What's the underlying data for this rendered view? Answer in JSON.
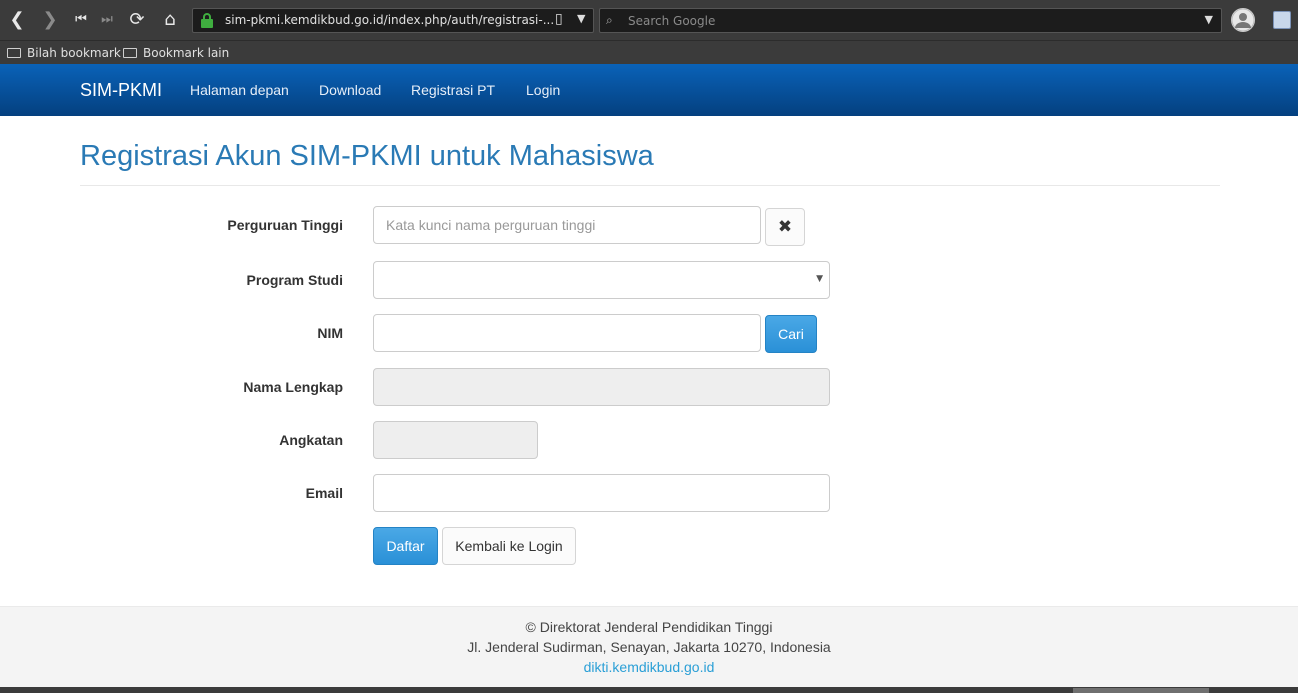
{
  "browser": {
    "url": "sim-pkmi.kemdikbud.go.id/index.php/auth/registrasi-...",
    "search_placeholder": "Search Google",
    "bookmarks": [
      "Bilah bookmark",
      "Bookmark lain"
    ]
  },
  "navbar": {
    "brand": "SIM-PKMI",
    "links": [
      "Halaman depan",
      "Download",
      "Registrasi PT",
      "Login"
    ]
  },
  "page": {
    "title": "Registrasi Akun SIM-PKMI untuk Mahasiswa"
  },
  "form": {
    "perguruan_tinggi": {
      "label": "Perguruan Tinggi",
      "placeholder": "Kata kunci nama perguruan tinggi",
      "value": ""
    },
    "program_studi": {
      "label": "Program Studi",
      "value": ""
    },
    "nim": {
      "label": "NIM",
      "value": "",
      "search_button": "Cari"
    },
    "nama_lengkap": {
      "label": "Nama Lengkap",
      "value": ""
    },
    "angkatan": {
      "label": "Angkatan",
      "value": ""
    },
    "email": {
      "label": "Email",
      "value": ""
    },
    "submit_button": "Daftar",
    "back_button": "Kembali ke Login"
  },
  "footer": {
    "line1": "© Direktorat Jenderal Pendidikan Tinggi",
    "line2": "Jl. Jenderal Sudirman, Senayan, Jakarta 10270, Indonesia",
    "link": "dikti.kemdikbud.go.id"
  },
  "colors": {
    "navbar": "#0a62b8",
    "title": "#2a7ab5",
    "primary_button": "#2a90d7",
    "link": "#2a9fd6"
  },
  "icons": [
    "back-arrow-icon",
    "forward-arrow-icon",
    "first-page-icon",
    "last-page-icon",
    "reload-icon",
    "home-icon",
    "lock-icon",
    "bookmark-icon",
    "search-icon",
    "profile-icon",
    "extension-icon",
    "folder-icon",
    "clear-x-icon",
    "select-caret-icon"
  ]
}
